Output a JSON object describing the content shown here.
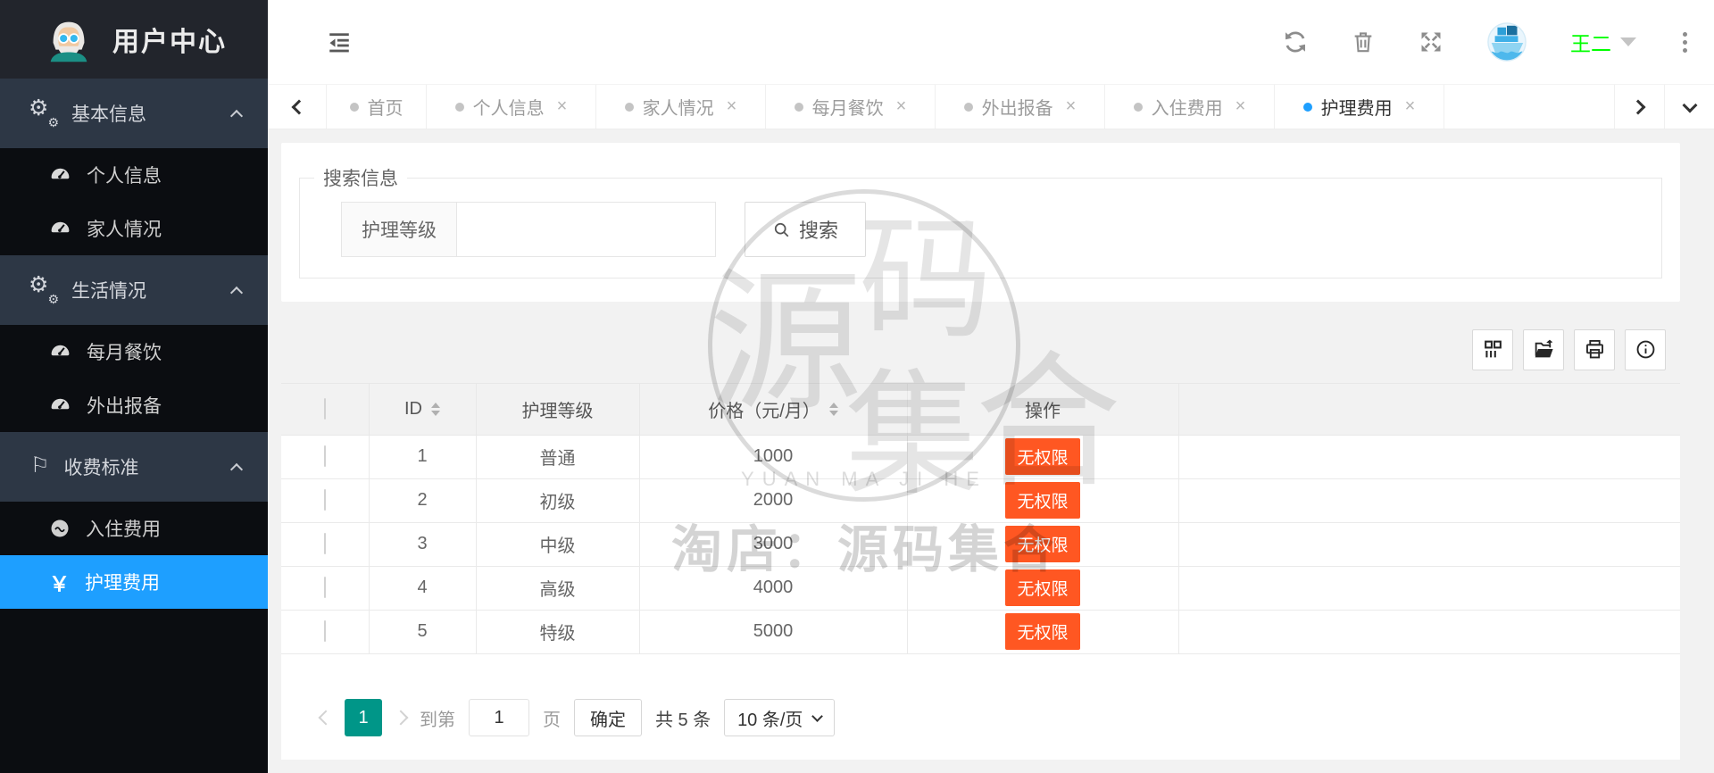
{
  "app": {
    "title": "用户中心"
  },
  "sidebar": {
    "groups": [
      {
        "label": "基本信息",
        "icon": "gears-icon",
        "children": [
          {
            "label": "个人信息",
            "icon": "gauge-icon"
          },
          {
            "label": "家人情况",
            "icon": "gauge-icon"
          }
        ]
      },
      {
        "label": "生活情况",
        "icon": "gears-icon",
        "children": [
          {
            "label": "每月餐饮",
            "icon": "gauge-icon"
          },
          {
            "label": "外出报备",
            "icon": "gauge-icon"
          }
        ]
      },
      {
        "label": "收费标准",
        "icon": "flag-icon",
        "children": [
          {
            "label": "入住费用",
            "icon": "circle-wave-icon"
          },
          {
            "label": "护理费用",
            "icon": "yen-icon",
            "active": true
          }
        ]
      }
    ]
  },
  "icons": {
    "gear": "⚙",
    "flag": "⚐",
    "yen": "￥"
  },
  "header": {
    "username": "王二"
  },
  "tabs": {
    "close_symbol": "×",
    "items": [
      {
        "label": "首页",
        "closable": false,
        "active": false
      },
      {
        "label": "个人信息",
        "closable": true,
        "active": false
      },
      {
        "label": "家人情况",
        "closable": true,
        "active": false
      },
      {
        "label": "每月餐饮",
        "closable": true,
        "active": false
      },
      {
        "label": "外出报备",
        "closable": true,
        "active": false
      },
      {
        "label": "入住费用",
        "closable": true,
        "active": false
      },
      {
        "label": "护理费用",
        "closable": true,
        "active": true
      }
    ]
  },
  "search": {
    "legend": "搜索信息",
    "field_label": "护理等级",
    "input_value": "",
    "button_label": "搜索"
  },
  "table": {
    "toolbar_icons": [
      "columns-icon",
      "export-icon",
      "print-icon",
      "info-icon"
    ],
    "columns": [
      "ID",
      "护理等级",
      "价格（元/月）",
      "操作"
    ],
    "sortable_columns": [
      "ID",
      "价格（元/月）"
    ],
    "action_label": "无权限",
    "rows": [
      {
        "id": "1",
        "grade": "普通",
        "price": "1000"
      },
      {
        "id": "2",
        "grade": "初级",
        "price": "2000"
      },
      {
        "id": "3",
        "grade": "中级",
        "price": "3000"
      },
      {
        "id": "4",
        "grade": "高级",
        "price": "4000"
      },
      {
        "id": "5",
        "grade": "特级",
        "price": "5000"
      }
    ]
  },
  "pagination": {
    "current_page": "1",
    "goto_prefix": "到第",
    "goto_value": "1",
    "goto_suffix": "页",
    "confirm_label": "确定",
    "total_label": "共 5 条",
    "page_size_label": "10 条/页"
  },
  "watermark": {
    "char_1": "源",
    "char_2": "码",
    "char_3": "集",
    "char_4": "合",
    "pinyin": "YUAN MA JI HE",
    "shop_label": "淘店：源码集合"
  },
  "colors": {
    "primary": "#1E9FFF",
    "pagination_active": "#009688",
    "action_button": "#FF5722",
    "username": "#00FF00",
    "sidebar_dark": "#0B0D11",
    "sidebar_group": "#2D3745"
  }
}
